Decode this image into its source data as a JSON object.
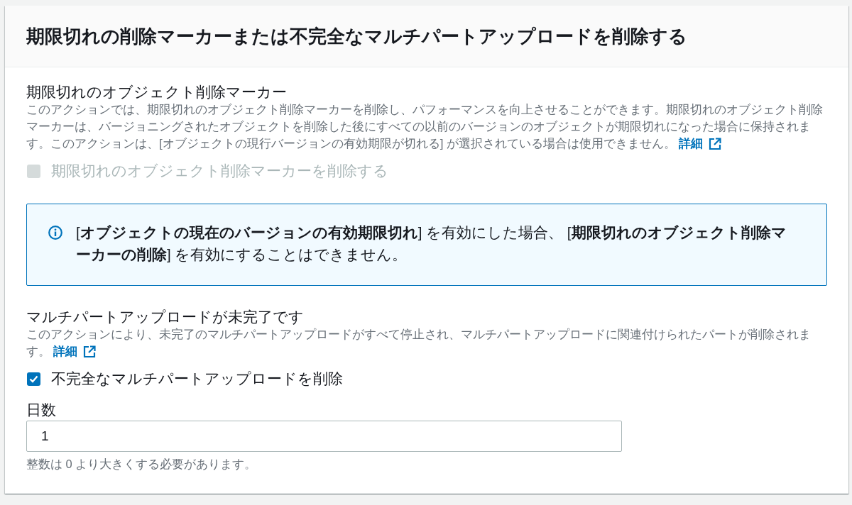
{
  "panel": {
    "title": "期限切れの削除マーカーまたは不完全なマルチパートアップロードを削除する"
  },
  "blocks": [
    {
      "kind": "option",
      "title": "期限切れのオブジェクト削除マーカー",
      "description": "このアクションでは、期限切れのオブジェクト削除マーカーを削除し、パフォーマンスを向上させることができます。期限切れのオブジェクト削除マーカーは、バージョニングされたオブジェクトを削除した後にすべての以前のバージョンのオブジェクトが期限切れになった場合に保持されます。このアクションは、[オブジェクトの現行バージョンの有効期限が切れる] が選択されている場合は使用できません。",
      "link": "詳細",
      "checkbox": {
        "label": "期限切れのオブジェクト削除マーカーを削除する",
        "checked": false,
        "disabled": true
      }
    },
    {
      "kind": "alert",
      "text": "[**オブジェクトの現在のバージョンの有効期限切れ**] を有効にした場合、 [**期限切れのオブジェクト削除マーカーの削除**] を有効にすることはできません。"
    },
    {
      "kind": "option",
      "title": "マルチパートアップロードが未完了です",
      "description": "このアクションにより、未完了のマルチパートアップロードがすべて停止され、マルチパートアップロードに関連付けられたパートが削除されます。",
      "link": "詳細",
      "checkbox": {
        "label": "不完全なマルチパートアップロードを削除",
        "checked": true,
        "disabled": false
      }
    },
    {
      "kind": "number-field",
      "label": "日数",
      "value": "1",
      "hint": "整数は 0 より大きくする必要があります。"
    }
  ]
}
